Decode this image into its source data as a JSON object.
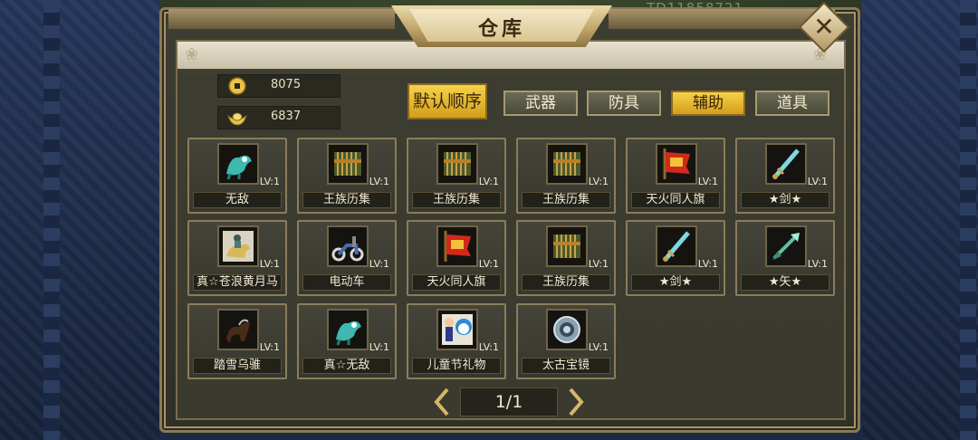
{
  "window": {
    "title": "仓库",
    "id_text": "TD11858721"
  },
  "currency": [
    {
      "icon": "gold-coin-icon",
      "value": "8075"
    },
    {
      "icon": "yuanbao-ingot-icon",
      "value": "6837"
    }
  ],
  "tabs": [
    {
      "label": "默认顺序",
      "state": "active"
    },
    {
      "label": "武器",
      "state": "normal"
    },
    {
      "label": "防具",
      "state": "normal"
    },
    {
      "label": "辅助",
      "state": "highlight"
    },
    {
      "label": "道具",
      "state": "normal"
    }
  ],
  "items": [
    {
      "name": "无敌",
      "level": "LV:1",
      "icon": "dragon-mount-icon"
    },
    {
      "name": "王族历集",
      "level": "LV:1",
      "icon": "scroll-book-icon"
    },
    {
      "name": "王族历集",
      "level": "LV:1",
      "icon": "scroll-book-icon"
    },
    {
      "name": "王族历集",
      "level": "LV:1",
      "icon": "scroll-book-icon"
    },
    {
      "name": "天火同人旗",
      "level": "LV:1",
      "icon": "war-banner-icon"
    },
    {
      "name": "★剑★",
      "level": "LV:1",
      "icon": "sword-icon"
    },
    {
      "name": "真☆苍浪黄月马",
      "level": "LV:1",
      "icon": "horse-rider-icon"
    },
    {
      "name": "电动车",
      "level": "LV:1",
      "icon": "scooter-icon"
    },
    {
      "name": "天火同人旗",
      "level": "LV:1",
      "icon": "war-banner-icon"
    },
    {
      "name": "王族历集",
      "level": "LV:1",
      "icon": "scroll-book-icon"
    },
    {
      "name": "★剑★",
      "level": "LV:1",
      "icon": "sword-icon"
    },
    {
      "name": "★矢★",
      "level": "LV:1",
      "icon": "arrow-icon"
    },
    {
      "name": "踏雪乌骓",
      "level": "LV:1",
      "icon": "black-horse-icon"
    },
    {
      "name": "真☆无敌",
      "level": "LV:1",
      "icon": "dragon-mount-icon"
    },
    {
      "name": "儿童节礼物",
      "level": "LV:1",
      "icon": "doraemon-gift-icon"
    },
    {
      "name": "太古宝镜",
      "level": "LV:1",
      "icon": "ancient-mirror-icon"
    }
  ],
  "pagination": {
    "label": "1/1"
  },
  "colors": {
    "tab_yellow": "#f4d24a",
    "panel_border": "#8a7a55",
    "text_light": "#f1ead3"
  }
}
